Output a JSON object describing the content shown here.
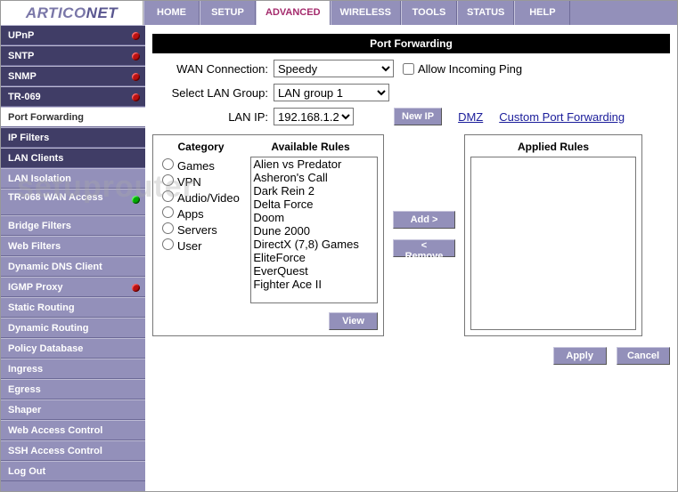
{
  "brand": {
    "a": "ARTICO",
    "b": "NET"
  },
  "topnav": [
    "HOME",
    "SETUP",
    "ADVANCED",
    "WIRELESS",
    "TOOLS",
    "STATUS",
    "HELP"
  ],
  "topnav_active": 2,
  "sidebar": [
    {
      "label": "UPnP",
      "dark": true,
      "dot": "red"
    },
    {
      "label": "SNTP",
      "dark": true,
      "dot": "red"
    },
    {
      "label": "SNMP",
      "dark": true,
      "dot": "red"
    },
    {
      "label": "TR-069",
      "dark": true,
      "dot": "red"
    },
    {
      "label": "Port Forwarding",
      "active": true
    },
    {
      "label": "IP Filters",
      "dark": true
    },
    {
      "label": "LAN Clients",
      "dark": true
    },
    {
      "label": "LAN Isolation"
    },
    {
      "label": "TR-068 WAN Access",
      "tall": true,
      "dot": "green"
    },
    {
      "label": "Bridge Filters"
    },
    {
      "label": "Web Filters"
    },
    {
      "label": "Dynamic DNS Client"
    },
    {
      "label": "IGMP Proxy",
      "dot": "red"
    },
    {
      "label": "Static Routing"
    },
    {
      "label": "Dynamic Routing"
    },
    {
      "label": "Policy Database"
    },
    {
      "label": "Ingress"
    },
    {
      "label": "Egress"
    },
    {
      "label": "Shaper"
    },
    {
      "label": "Web Access Control"
    },
    {
      "label": "SSH Access Control"
    },
    {
      "label": "Log Out"
    }
  ],
  "page_title": "Port Forwarding",
  "labels": {
    "wan": "WAN Connection:",
    "lg": "Select LAN Group:",
    "ip": "LAN IP:",
    "ping": "Allow Incoming Ping",
    "newip": "New IP",
    "dmz": "DMZ",
    "cpf": "Custom Port Forwarding",
    "category": "Category",
    "avail": "Available Rules",
    "applied": "Applied Rules",
    "add": "Add >",
    "remove": "< Remove",
    "view": "View",
    "apply": "Apply",
    "cancel": "Cancel"
  },
  "wan_value": "Speedy",
  "lg_value": "LAN group 1",
  "ip_value": "192.168.1.2",
  "categories": [
    "Games",
    "VPN",
    "Audio/Video",
    "Apps",
    "Servers",
    "User"
  ],
  "available_rules": [
    "Alien vs Predator",
    "Asheron's Call",
    "Dark Rein 2",
    "Delta Force",
    "Doom",
    "Dune 2000",
    "DirectX (7,8) Games",
    "EliteForce",
    "EverQuest",
    "Fighter Ace II"
  ],
  "watermark": "setuprouter"
}
